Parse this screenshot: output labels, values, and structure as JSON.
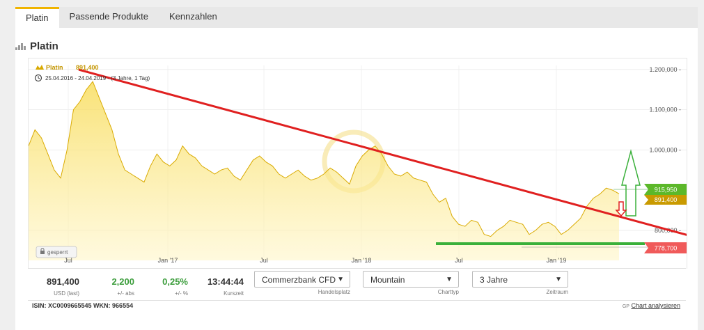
{
  "tabs": [
    {
      "label": "Platin"
    },
    {
      "label": "Passende Produkte"
    },
    {
      "label": "Kennzahlen"
    }
  ],
  "card": {
    "title": "Platin"
  },
  "chart_data": {
    "type": "area",
    "legend": {
      "name": "Platin",
      "value": "891,400"
    },
    "period_label": "25.04.2016 - 24.04.2019 - (3 Jahre, 1 Tag)",
    "x_ticks": [
      "Jul",
      "Jan '17",
      "Jul",
      "Jan '18",
      "Jul",
      "Jan '19"
    ],
    "y_ticks": [
      "1.200,000",
      "1.100,000",
      "1.000,000",
      "800,000"
    ],
    "ylim": [
      760,
      1210
    ],
    "series": [
      {
        "values": [
          1010,
          1050,
          1030,
          990,
          950,
          930,
          1000,
          1100,
          1120,
          1150,
          1170,
          1130,
          1090,
          1050,
          990,
          950,
          940,
          930,
          920,
          960,
          990,
          970,
          960,
          975,
          1010,
          990,
          980,
          960,
          950,
          940,
          950,
          955,
          935,
          925,
          950,
          975,
          985,
          970,
          960,
          940,
          930,
          940,
          950,
          935,
          925,
          930,
          940,
          955,
          945,
          930,
          915,
          960,
          985,
          1000,
          1010,
          990,
          960,
          940,
          935,
          945,
          930,
          925,
          920,
          890,
          870,
          880,
          835,
          815,
          810,
          825,
          820,
          790,
          785,
          800,
          810,
          825,
          820,
          815,
          790,
          800,
          815,
          820,
          810,
          790,
          800,
          815,
          830,
          860,
          880,
          890,
          905,
          900,
          891
        ]
      }
    ],
    "levels": {
      "high": "915,950",
      "last": "891,400",
      "low": "778,700"
    },
    "badge": "gesperrt"
  },
  "footer": {
    "last": {
      "value": "891,400",
      "label": "USD (last)"
    },
    "abs": {
      "value": "2,200",
      "label": "+/- abs"
    },
    "pct": {
      "value": "0,25%",
      "label": "+/- %"
    },
    "time": {
      "value": "13:44:44",
      "label": "Kurszeit"
    },
    "selects": [
      {
        "value": "Commerzbank CFD",
        "label": "Handelsplatz"
      },
      {
        "value": "Mountain",
        "label": "Charttyp"
      },
      {
        "value": "3 Jahre",
        "label": "Zeitraum"
      }
    ],
    "isin": "ISIN: XC0009665545 WKN: 966554",
    "analyse": "Chart analysieren",
    "analyse_prefix": "GP"
  },
  "colors": {
    "accent": "#f0b400",
    "up": "#3c9d3c",
    "down": "#e02020"
  }
}
